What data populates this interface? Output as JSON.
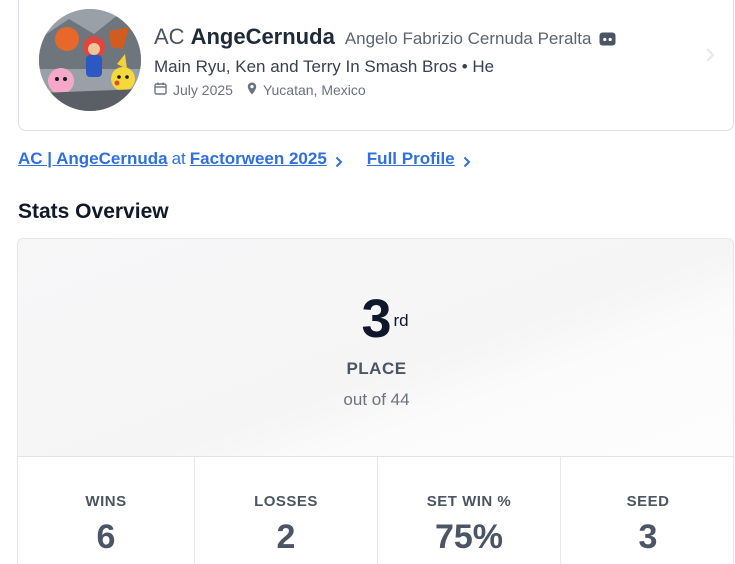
{
  "profile": {
    "prefix": "AC",
    "gamertag": "AngeCernuda",
    "real_name": "Angelo Fabrizio Cernuda Peralta",
    "bio": "Main Ryu, Ken and Terry In Smash Bros • He",
    "joined": "July 2025",
    "location": "Yucatan, Mexico",
    "social_icon": "discord-icon",
    "avatar_description": "Smash Bros characters artwork"
  },
  "links": {
    "event_player": "AC | AngeCernuda",
    "at": "at",
    "event_name": "Factorween 2025",
    "full_profile": "Full Profile"
  },
  "stats": {
    "section_title": "Stats Overview",
    "place": "3",
    "place_suffix": "rd",
    "place_label": "PLACE",
    "out_of": "out of 44",
    "items": [
      {
        "label": "WINS",
        "value": "6"
      },
      {
        "label": "LOSSES",
        "value": "2"
      },
      {
        "label": "SET WIN %",
        "value": "75%"
      },
      {
        "label": "SEED",
        "value": "3"
      }
    ]
  },
  "colors": {
    "link": "#2f6fde",
    "text_dark": "#1f2937",
    "text_muted": "#6b7280",
    "border": "#dcdfe4"
  }
}
